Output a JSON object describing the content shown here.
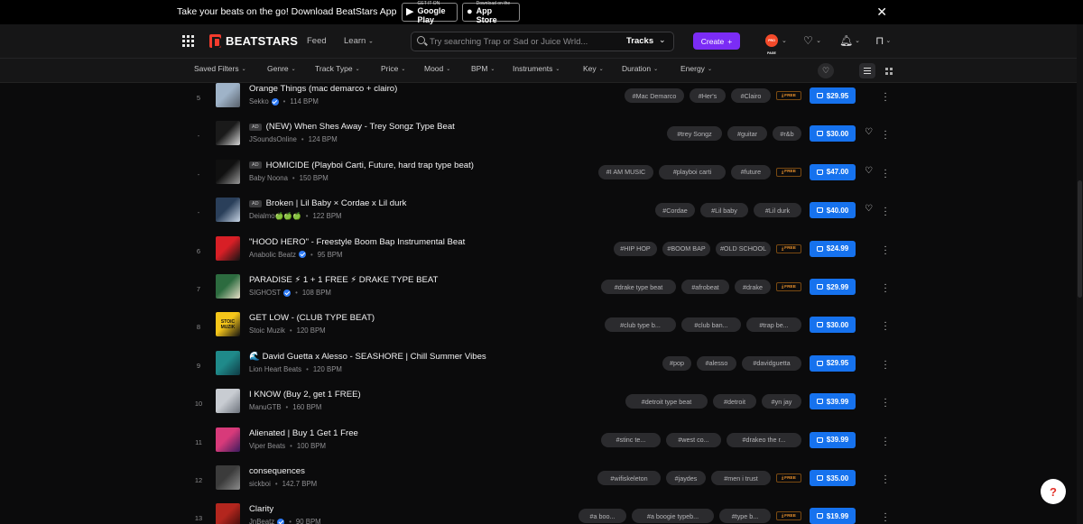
{
  "promo": {
    "text": "Take your beats on the go! Download BeatStars App",
    "google_play_small": "GET IT ON",
    "google_play": "Google Play",
    "app_store_small": "Download on the",
    "app_store": "App Store"
  },
  "nav": {
    "brand": "BEATSTARS",
    "feed": "Feed",
    "learn": "Learn",
    "search_placeholder": "Try searching Trap or Sad or Juice Wrld...",
    "search_scope": "Tracks",
    "create": "Create",
    "avatar_text": "PRO PAGE"
  },
  "filters": [
    "Saved Filters",
    "Genre",
    "Track Type",
    "Price",
    "Mood",
    "BPM",
    "Instruments",
    "Key",
    "Duration",
    "Energy"
  ],
  "free_label": "FREE",
  "tracks": [
    {
      "rank": "5",
      "ad": false,
      "title": "Orange Things (mac demarco + clairo)",
      "artist": "Sekko",
      "verified": true,
      "bpm": "114 BPM",
      "tags": [
        "#Mac Demarco",
        "#Her's",
        "#Clairo"
      ],
      "free": true,
      "price": "$29.95",
      "heart": false,
      "thumb": [
        "#9fb3c8",
        "#58606a"
      ]
    },
    {
      "rank": "-",
      "ad": true,
      "ad_label": "AD",
      "title": "(NEW) When Shes Away - Trey Songz Type Beat",
      "artist": "JSoundsOnline",
      "verified": false,
      "bpm": "124 BPM",
      "tags": [
        "#trey Songz",
        "#guitar",
        "#r&b"
      ],
      "free": false,
      "price": "$30.00",
      "heart": true,
      "thumb": [
        "#1a1a1a",
        "#d8d8d8"
      ]
    },
    {
      "rank": "-",
      "ad": true,
      "ad_label": "AD",
      "title": "HOMICIDE (Playboi Carti, Future, hard trap type beat)",
      "artist": "Baby Noona",
      "verified": false,
      "bpm": "150 BPM",
      "tags": [
        "#I AM MUSIC",
        "#playboi carti",
        "#future"
      ],
      "free": true,
      "price": "$47.00",
      "heart": true,
      "thumb": [
        "#101010",
        "#9a9a9a"
      ]
    },
    {
      "rank": "-",
      "ad": true,
      "ad_label": "AD",
      "title": "Broken | Lil Baby × Cordae x Lil durk",
      "artist": "Deialmo🍏🍏🍏",
      "verified": false,
      "bpm": "122 BPM",
      "tags": [
        "#Cordae",
        "#Lil baby",
        "#Lil durk"
      ],
      "free": false,
      "price": "$40.00",
      "heart": true,
      "thumb": [
        "#2a3f5a",
        "#c9d6e6"
      ]
    },
    {
      "rank": "6",
      "ad": false,
      "title": "\"HOOD HERO\" - Freestyle Boom Bap Instrumental Beat",
      "artist": "Anabolic Beatz",
      "verified": true,
      "bpm": "95 BPM",
      "tags": [
        "#HIP HOP",
        "#BOOM BAP",
        "#OLD SCHOOL"
      ],
      "free": true,
      "price": "$24.99",
      "heart": false,
      "thumb": [
        "#d81f26",
        "#141414"
      ]
    },
    {
      "rank": "7",
      "ad": false,
      "title": "PARADISE ⚡ 1 + 1 FREE ⚡ DRAKE TYPE BEAT",
      "artist": "SIGHOST",
      "verified": true,
      "bpm": "108 BPM",
      "tags": [
        "#drake type beat",
        "#afrobeat",
        "#drake"
      ],
      "free": true,
      "price": "$29.99",
      "heart": false,
      "thumb": [
        "#2c6b3f",
        "#e9e0c8"
      ]
    },
    {
      "rank": "8",
      "ad": false,
      "title": "GET LOW - (CLUB TYPE BEAT)",
      "artist": "Stoic Muzik",
      "verified": false,
      "bpm": "120 BPM",
      "tags": [
        "#club type b...",
        "#club ban...",
        "#trap be..."
      ],
      "free": false,
      "price": "$30.00",
      "heart": false,
      "thumb": [
        "#f6c61a",
        "#111111"
      ],
      "thumb_text": "STOIC MUZIK"
    },
    {
      "rank": "9",
      "ad": false,
      "title": "🌊 David Guetta x Alesso - SEASHORE | Chill Summer Vibes",
      "artist": "Lion Heart Beats",
      "verified": false,
      "bpm": "120 BPM",
      "tags": [
        "#pop",
        "#alesso",
        "#davidguetta"
      ],
      "free": false,
      "price": "$29.95",
      "heart": false,
      "thumb": [
        "#1f8a8a",
        "#0f3b45"
      ]
    },
    {
      "rank": "10",
      "ad": false,
      "title": "I KNOW (Buy 2, get 1 FREE)",
      "artist": "ManuGTB",
      "verified": false,
      "bpm": "160 BPM",
      "tags": [
        "#detroit type beat",
        "#detroit",
        "#yn jay"
      ],
      "free": false,
      "price": "$39.99",
      "heart": false,
      "thumb": [
        "#c8ccd2",
        "#6d737c"
      ]
    },
    {
      "rank": "11",
      "ad": false,
      "title": "Alienated | Buy 1 Get 1 Free",
      "artist": "Viper Beats",
      "verified": false,
      "bpm": "100 BPM",
      "tags": [
        "#stinc te...",
        "#west co...",
        "#drakeo the r..."
      ],
      "free": false,
      "price": "$39.99",
      "heart": false,
      "thumb": [
        "#d83a7a",
        "#3a1b5e"
      ]
    },
    {
      "rank": "12",
      "ad": false,
      "title": "consequences",
      "artist": "sickboi",
      "verified": false,
      "bpm": "142.7 BPM",
      "tags": [
        "#wifiskeleton",
        "#jaydes",
        "#men i trust"
      ],
      "free": true,
      "price": "$35.00",
      "heart": false,
      "thumb": [
        "#3b3b3b",
        "#8c8c8c"
      ]
    },
    {
      "rank": "13",
      "ad": false,
      "title": "Clarity",
      "artist": "JnBeatz",
      "verified": true,
      "bpm": "90 BPM",
      "tags": [
        "#a boo...",
        "#a boogie typeb...",
        "#type b..."
      ],
      "free": true,
      "price": "$19.99",
      "heart": false,
      "thumb": [
        "#b3261e",
        "#3c0b09"
      ]
    }
  ],
  "help": "?"
}
